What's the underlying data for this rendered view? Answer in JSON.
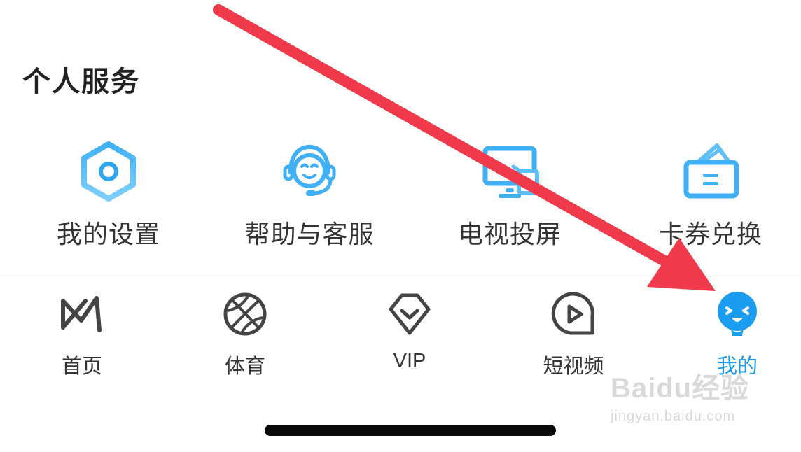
{
  "section": {
    "title": "个人服务"
  },
  "services": [
    {
      "label": "我的设置",
      "icon": "settings-hex-icon"
    },
    {
      "label": "帮助与客服",
      "icon": "customer-service-icon"
    },
    {
      "label": "电视投屏",
      "icon": "tv-cast-icon"
    },
    {
      "label": "卡券兑换",
      "icon": "coupon-wallet-icon"
    }
  ],
  "tabbar": {
    "active_index": 4,
    "items": [
      {
        "label": "首页",
        "icon": "home-logo-icon"
      },
      {
        "label": "体育",
        "icon": "basketball-icon"
      },
      {
        "label": "VIP",
        "icon": "vip-shield-icon"
      },
      {
        "label": "短视频",
        "icon": "short-video-icon"
      },
      {
        "label": "我的",
        "icon": "profile-mascot-icon"
      }
    ]
  },
  "watermark": {
    "brand": "Baidu经验",
    "site": "jingyan.baidu.com"
  },
  "colors": {
    "accent": "#1a9df0",
    "annotation_arrow": "#f03a4c",
    "text": "#333333"
  }
}
